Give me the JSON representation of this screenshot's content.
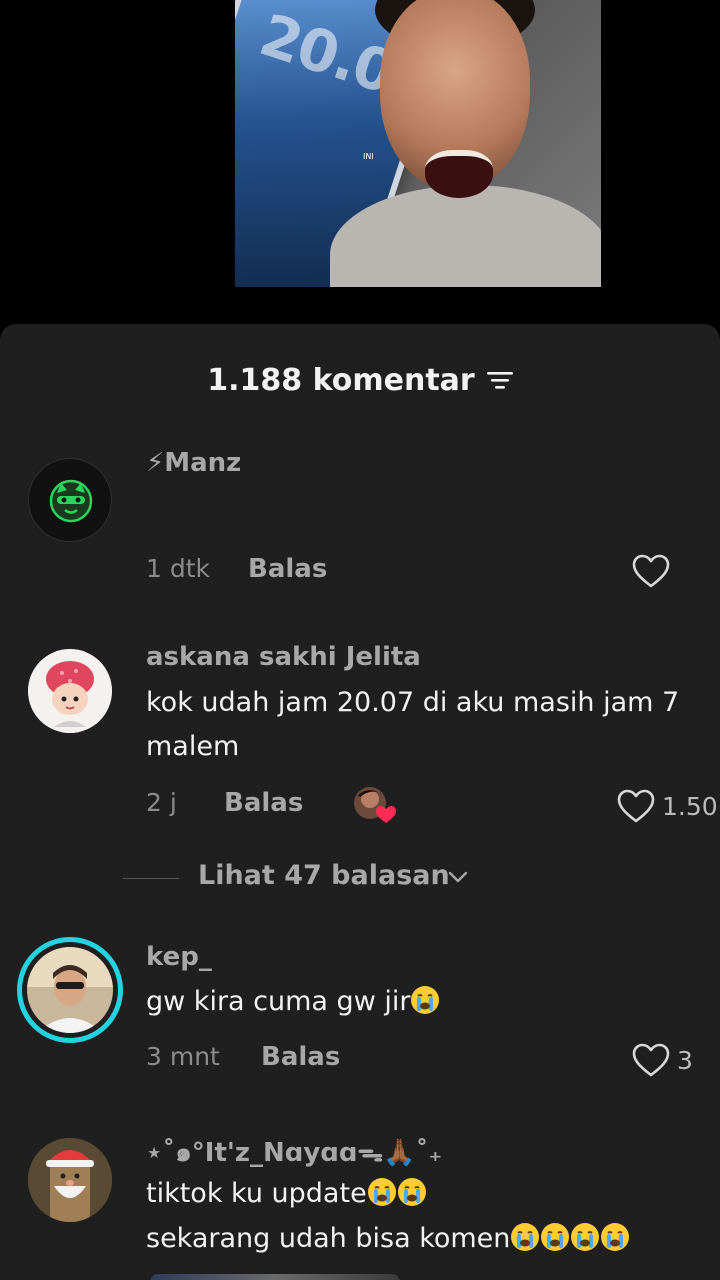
{
  "video": {
    "phone_clock": "20.07",
    "caption_tag": "INI"
  },
  "comments_header": {
    "count_label": "1.188 komentar",
    "filter_icon": "filter-icon"
  },
  "comments": [
    {
      "username": "⚡Manz",
      "text": "",
      "time": "1 dtk",
      "reply_label": "Balas",
      "likes": "",
      "avatar_icon": "raccoon-badge-icon"
    },
    {
      "username": "askana sakhi Jelita",
      "text_line1": "kok udah jam 20.07 di aku masih jam 7",
      "text_line2": "malem",
      "time": "2 j",
      "reply_label": "Balas",
      "likes": "1.50",
      "avatar_icon": "memoji-avatar"
    },
    {
      "username": "kep_",
      "text": "gw kira cuma gw jir",
      "time": "3 mnt",
      "reply_label": "Balas",
      "likes": "3",
      "avatar_icon": "photo-avatar"
    },
    {
      "username": "⋆˚๑°It'z_Nɑyɑɑᯓ🙏🏾˚₊",
      "text_line1": "tiktok ku update",
      "text_line2": "sekarang udah bisa komen",
      "avatar_icon": "santa-avatar"
    }
  ],
  "view_replies": {
    "label": "Lihat 47 balasan"
  },
  "colors": {
    "sheet_bg": "#1f1f1f",
    "accent_green": "#2bd45a",
    "story_ring": "#24d3e0",
    "heart_red": "#ff2b55"
  }
}
